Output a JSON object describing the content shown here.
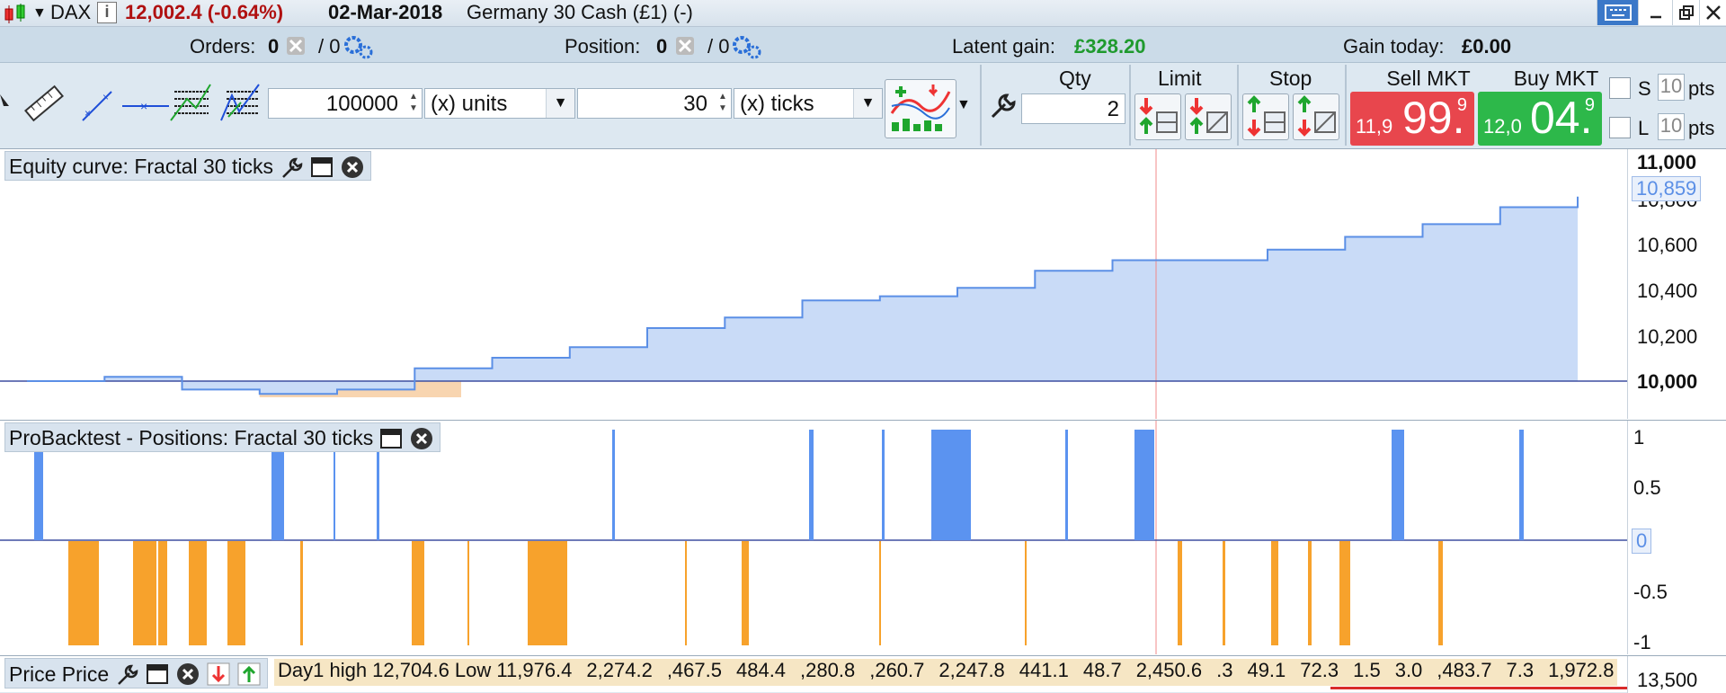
{
  "titlebar": {
    "symbol": "DAX",
    "info_icon": "i",
    "price_change": "12,002.4 (-0.64%)",
    "date": "02-Mar-2018",
    "instrument": "Germany 30 Cash (£1) (-)"
  },
  "infobar": {
    "orders_label": "Orders:",
    "orders_value": "0",
    "orders_sep": "/ 0",
    "position_label": "Position:",
    "position_value": "0",
    "position_sep": "/ 0",
    "latent_label": "Latent gain:",
    "latent_value": "£328.20",
    "gain_label": "Gain today:",
    "gain_value": "£0.00"
  },
  "toolbar": {
    "units_value": "100000",
    "units_select": "(x) units",
    "ticks_value": "30",
    "ticks_select": "(x) ticks"
  },
  "order_panel": {
    "qty_label": "Qty",
    "qty_value": "2",
    "limit_label": "Limit",
    "stop_label": "Stop",
    "sell_label": "Sell MKT",
    "sell_small": "11,9",
    "sell_big": "99.",
    "sell_sup": "9",
    "buy_label": "Buy MKT",
    "buy_small": "12,0",
    "buy_big": "04.",
    "buy_sup": "9",
    "s_label": "S",
    "s_pts": "10",
    "l_label": "L",
    "l_pts": "10",
    "pts_label": "pts"
  },
  "equity_panel": {
    "title": "Equity curve: Fractal 30 ticks",
    "axis_ticks": [
      "11,000",
      "10,800",
      "10,600",
      "10,400",
      "10,200",
      "10,000"
    ],
    "current_value": "10,859"
  },
  "positions_panel": {
    "title": "ProBacktest - Positions: Fractal 30 ticks",
    "axis_ticks": [
      "1",
      "0.5",
      "0",
      "-0.5",
      "-1"
    ]
  },
  "price_panel": {
    "title": "Price Price",
    "strip_text": [
      "Day1 high 12,704.6 Low 11,976.4",
      "2,274.2",
      ",467.5",
      "484.4",
      ",280.8",
      ",260.7",
      "2,247.8",
      "441.1",
      "48.7",
      "2,450.6",
      ".3",
      "49.1",
      "72.3",
      "1.5",
      "3.0",
      ",483.7",
      "7.3",
      "1,972.8"
    ],
    "axis_tick": "13,500"
  },
  "colors": {
    "equity_line": "#5b8fe6",
    "equity_fill": "#c9dbf7",
    "loss_fill": "#f8d5b0",
    "orange": "#f7a22c",
    "blue_bar": "#5b93f0",
    "sell": "#e8464d",
    "buy": "#2db84a"
  },
  "chart_data": {
    "type": "line",
    "series": [
      {
        "x": [
          0,
          5,
          10,
          15,
          20,
          25,
          30,
          35,
          40,
          45,
          50,
          55,
          60,
          65,
          70,
          75,
          80,
          85,
          90,
          95,
          100
        ],
        "values": [
          10000,
          10020,
          9960,
          9940,
          9960,
          10060,
          10110,
          10160,
          10250,
          10300,
          10380,
          10400,
          10440,
          10520,
          10570,
          10570,
          10620,
          10680,
          10740,
          10820,
          10870
        ]
      }
    ],
    "ylim": [
      9900,
      11000
    ]
  }
}
